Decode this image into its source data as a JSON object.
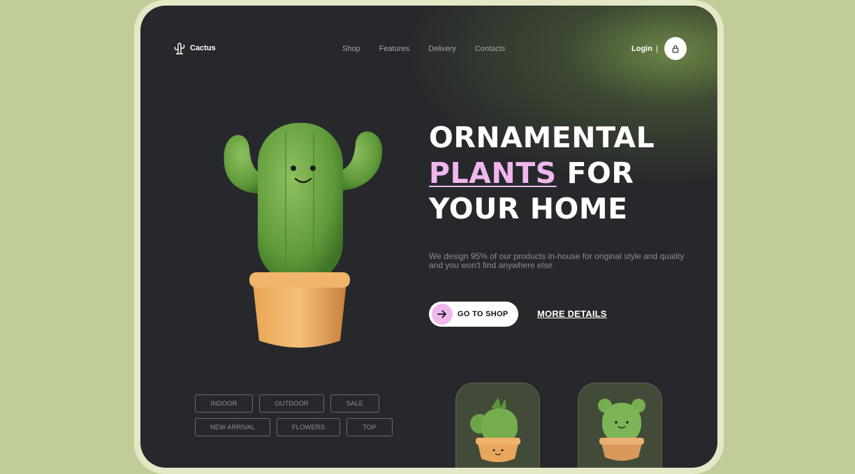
{
  "brand": {
    "name": "Cactus",
    "icon": "cactus-icon"
  },
  "nav": {
    "items": [
      "Shop",
      "Features",
      "Delivery",
      "Contacts"
    ]
  },
  "auth": {
    "login_label": "Login",
    "separator": "|",
    "lock_icon": "lock-icon"
  },
  "hero": {
    "line1": "ORNAMENTAL",
    "line2_highlight": "PLANTS",
    "line2_rest": " FOR",
    "line3": "YOUR HOME",
    "subtitle": "We design 95% of our products in-house for original style and quality and you won't find anywhere else",
    "primary_cta": "GO TO SHOP",
    "secondary_cta": "MORE DETAILS"
  },
  "tags": {
    "row1": [
      "INDOOR",
      "OUTDOOR",
      "SALE"
    ],
    "row2": [
      "NEW ARRIVAL",
      "FLOWERS",
      "TOP"
    ]
  },
  "colors": {
    "accent_pink": "#efb7ee",
    "card_bg": "#27282c",
    "page_bg": "#c1cd98",
    "product_card_bg": "#414b38"
  }
}
